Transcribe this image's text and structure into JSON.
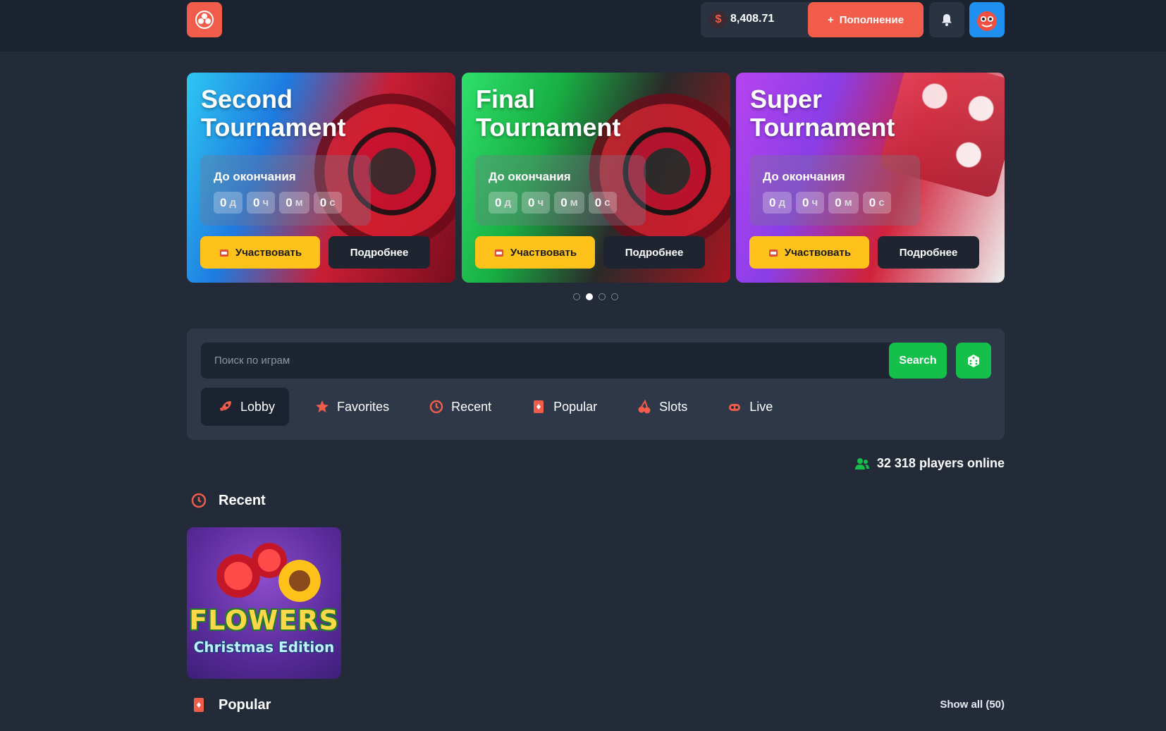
{
  "header": {
    "balance_symbol": "$",
    "balance": "8,408.71",
    "deposit_label": "Пополнение",
    "deposit_icon": "+"
  },
  "banners": [
    {
      "title_line1": "Second",
      "title_line2": "Tournament",
      "countdown_label": "До окончания",
      "units": [
        {
          "num": "0",
          "suffix": "д"
        },
        {
          "num": "0",
          "suffix": "ч"
        },
        {
          "num": "0",
          "suffix": "м"
        },
        {
          "num": "0",
          "suffix": "с"
        }
      ],
      "join_label": "Участвовать",
      "more_label": "Подробнее"
    },
    {
      "title_line1": "Final",
      "title_line2": "Tournament",
      "countdown_label": "До окончания",
      "units": [
        {
          "num": "0",
          "suffix": "д"
        },
        {
          "num": "0",
          "suffix": "ч"
        },
        {
          "num": "0",
          "suffix": "м"
        },
        {
          "num": "0",
          "suffix": "с"
        }
      ],
      "join_label": "Участвовать",
      "more_label": "Подробнее"
    },
    {
      "title_line1": "Super",
      "title_line2": "Tournament",
      "countdown_label": "До окончания",
      "units": [
        {
          "num": "0",
          "suffix": "д"
        },
        {
          "num": "0",
          "suffix": "ч"
        },
        {
          "num": "0",
          "suffix": "м"
        },
        {
          "num": "0",
          "suffix": "с"
        }
      ],
      "join_label": "Участвовать",
      "more_label": "Подробнее"
    }
  ],
  "carousel": {
    "total": 4,
    "active_index": 1
  },
  "search": {
    "placeholder": "Поиск по играм",
    "value": "",
    "button_label": "Search"
  },
  "tabs": [
    {
      "label": "Lobby",
      "icon": "rocket-icon",
      "active": true
    },
    {
      "label": "Favorites",
      "icon": "star-icon",
      "active": false
    },
    {
      "label": "Recent",
      "icon": "history-icon",
      "active": false
    },
    {
      "label": "Popular",
      "icon": "cards-icon",
      "active": false
    },
    {
      "label": "Slots",
      "icon": "cherry-icon",
      "active": false
    },
    {
      "label": "Live",
      "icon": "live-icon",
      "active": false
    }
  ],
  "online": {
    "text": "32 318 players online"
  },
  "sections": {
    "recent_title": "Recent",
    "popular_title": "Popular",
    "show_all": "Show all (50)"
  },
  "recent_games": [
    {
      "title_line1": "FLOWERS",
      "title_line2": "Christmas Edition"
    }
  ],
  "colors": {
    "accent": "#f25c4a",
    "success": "#14c04a",
    "background": "#232b38",
    "header": "#1c2330",
    "panel": "#2e3849",
    "join": "#ffc21a"
  }
}
